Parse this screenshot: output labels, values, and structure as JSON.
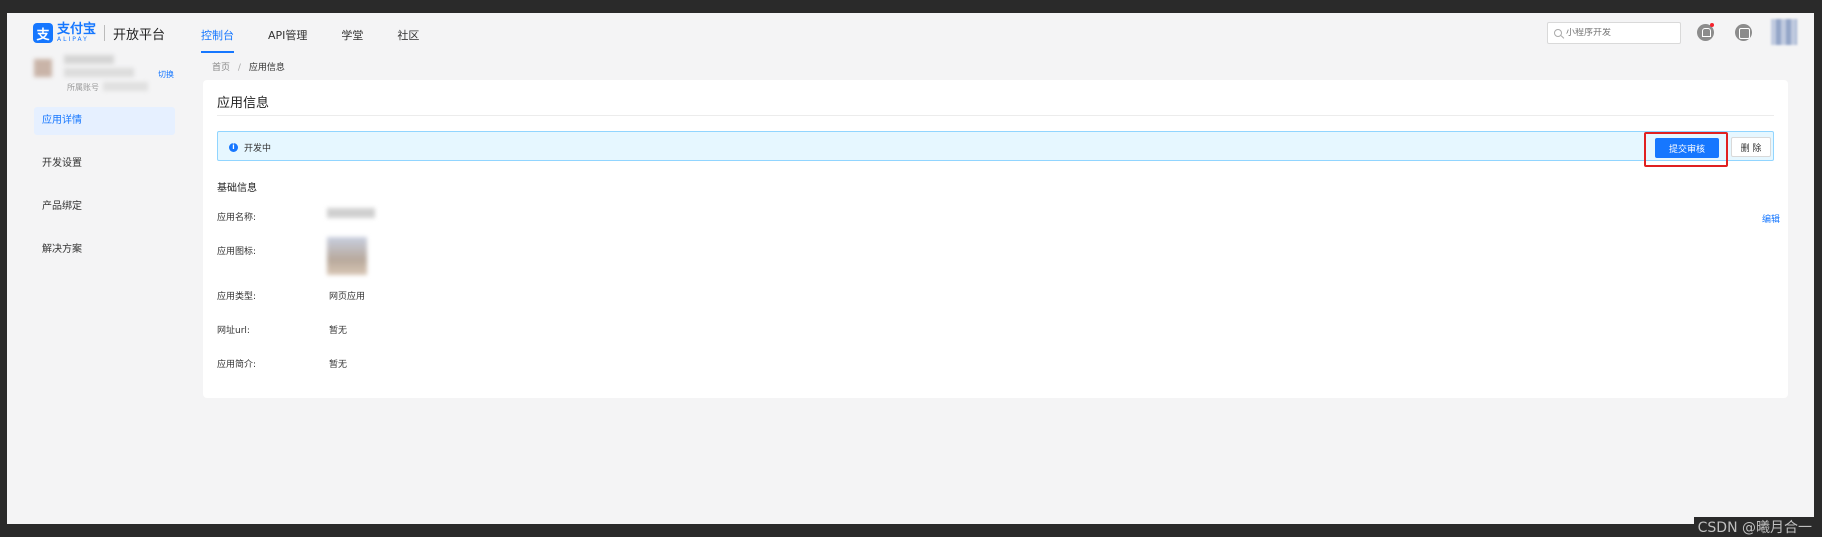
{
  "header": {
    "logo_cn": "支付宝",
    "logo_en": "ALIPAY",
    "platform": "开放平台",
    "nav": [
      {
        "label": "控制台",
        "active": true
      },
      {
        "label": "API管理",
        "active": false
      },
      {
        "label": "学堂",
        "active": false
      },
      {
        "label": "社区",
        "active": false
      }
    ],
    "search_placeholder": "小程序开发"
  },
  "account": {
    "label": "所属账号",
    "switch_label": "切换"
  },
  "sidebar": {
    "items": [
      {
        "label": "应用详情",
        "active": true
      },
      {
        "label": "开发设置",
        "active": false
      },
      {
        "label": "产品绑定",
        "active": false
      },
      {
        "label": "解决方案",
        "active": false
      }
    ]
  },
  "breadcrumb": {
    "home": "首页",
    "separator": "/",
    "current": "应用信息"
  },
  "card": {
    "title": "应用信息",
    "status": "开发中",
    "status_icon": "i",
    "submit_label": "提交审核",
    "delete_label": "删 除",
    "section_title": "基础信息",
    "edit_label": "编辑",
    "fields": [
      {
        "label": "应用名称:",
        "value": ""
      },
      {
        "label": "应用图标:",
        "value": ""
      },
      {
        "label": "应用类型:",
        "value": "网页应用"
      },
      {
        "label": "网址url:",
        "value": "暂无"
      },
      {
        "label": "应用简介:",
        "value": "暂无"
      }
    ]
  },
  "watermark": "CSDN @曦月合一",
  "colors": {
    "accent": "#1677ff",
    "status_bg": "#e6f7ff",
    "highlight": "#e02020"
  }
}
